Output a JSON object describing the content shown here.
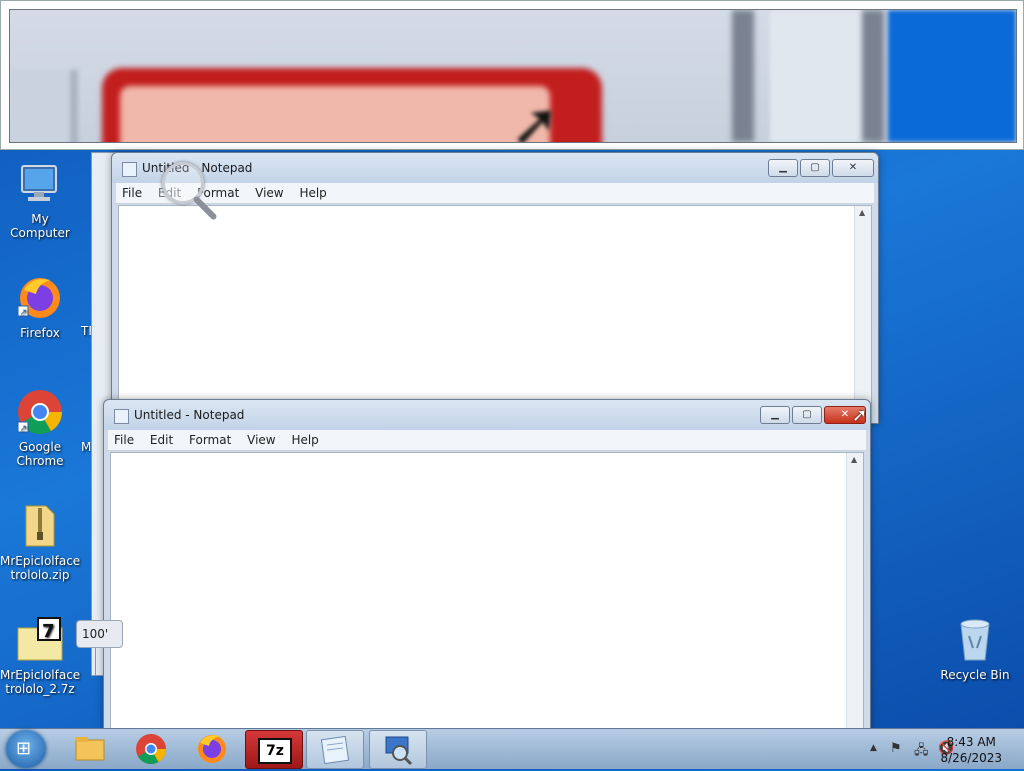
{
  "desktop": {
    "icons": [
      {
        "label": "My Computer",
        "icon": "computer-icon"
      },
      {
        "label": "Firefox",
        "icon": "firefox-icon"
      },
      {
        "label": "Google Chrome",
        "icon": "chrome-icon"
      },
      {
        "label": "MrEpicIolface trololo.zip",
        "icon": "zip-folder-icon"
      },
      {
        "label": "MrEpicIolface trololo_2.7z",
        "icon": "7z-archive-icon"
      },
      {
        "label": "Recycle Bin",
        "icon": "recycle-bin-icon"
      }
    ],
    "partial_labels": [
      "TF",
      "M"
    ]
  },
  "windows": {
    "back_notepad": {
      "title": "Untitled - Notepad",
      "menu": [
        "File",
        "Edit",
        "Format",
        "View",
        "Help"
      ],
      "buttons": {
        "minimize": "minimize-icon",
        "maximize": "maximize-icon",
        "close": "close-icon"
      }
    },
    "front_notepad": {
      "title": "Untitled - Notepad",
      "menu": [
        "File",
        "Edit",
        "Format",
        "View",
        "Help"
      ],
      "buttons": {
        "minimize": "minimize-icon",
        "maximize": "maximize-icon",
        "close": "close-icon"
      }
    }
  },
  "zoom_badge": "100'",
  "taskbar": {
    "items": [
      {
        "name": "explorer",
        "icon": "folder-icon"
      },
      {
        "name": "chrome",
        "icon": "chrome-icon"
      },
      {
        "name": "firefox",
        "icon": "firefox-icon"
      },
      {
        "name": "7zip",
        "icon": "7z-icon",
        "label": "7z"
      },
      {
        "name": "notepad",
        "icon": "notepad-icon"
      },
      {
        "name": "magnifier",
        "icon": "magnifier-icon"
      }
    ],
    "clock": {
      "time": "8:43 AM",
      "date": "8/26/2023"
    }
  },
  "colors": {
    "desktop_blue": "#1a78d8",
    "close_red": "#c7311b",
    "seven_red": "#d53838"
  }
}
